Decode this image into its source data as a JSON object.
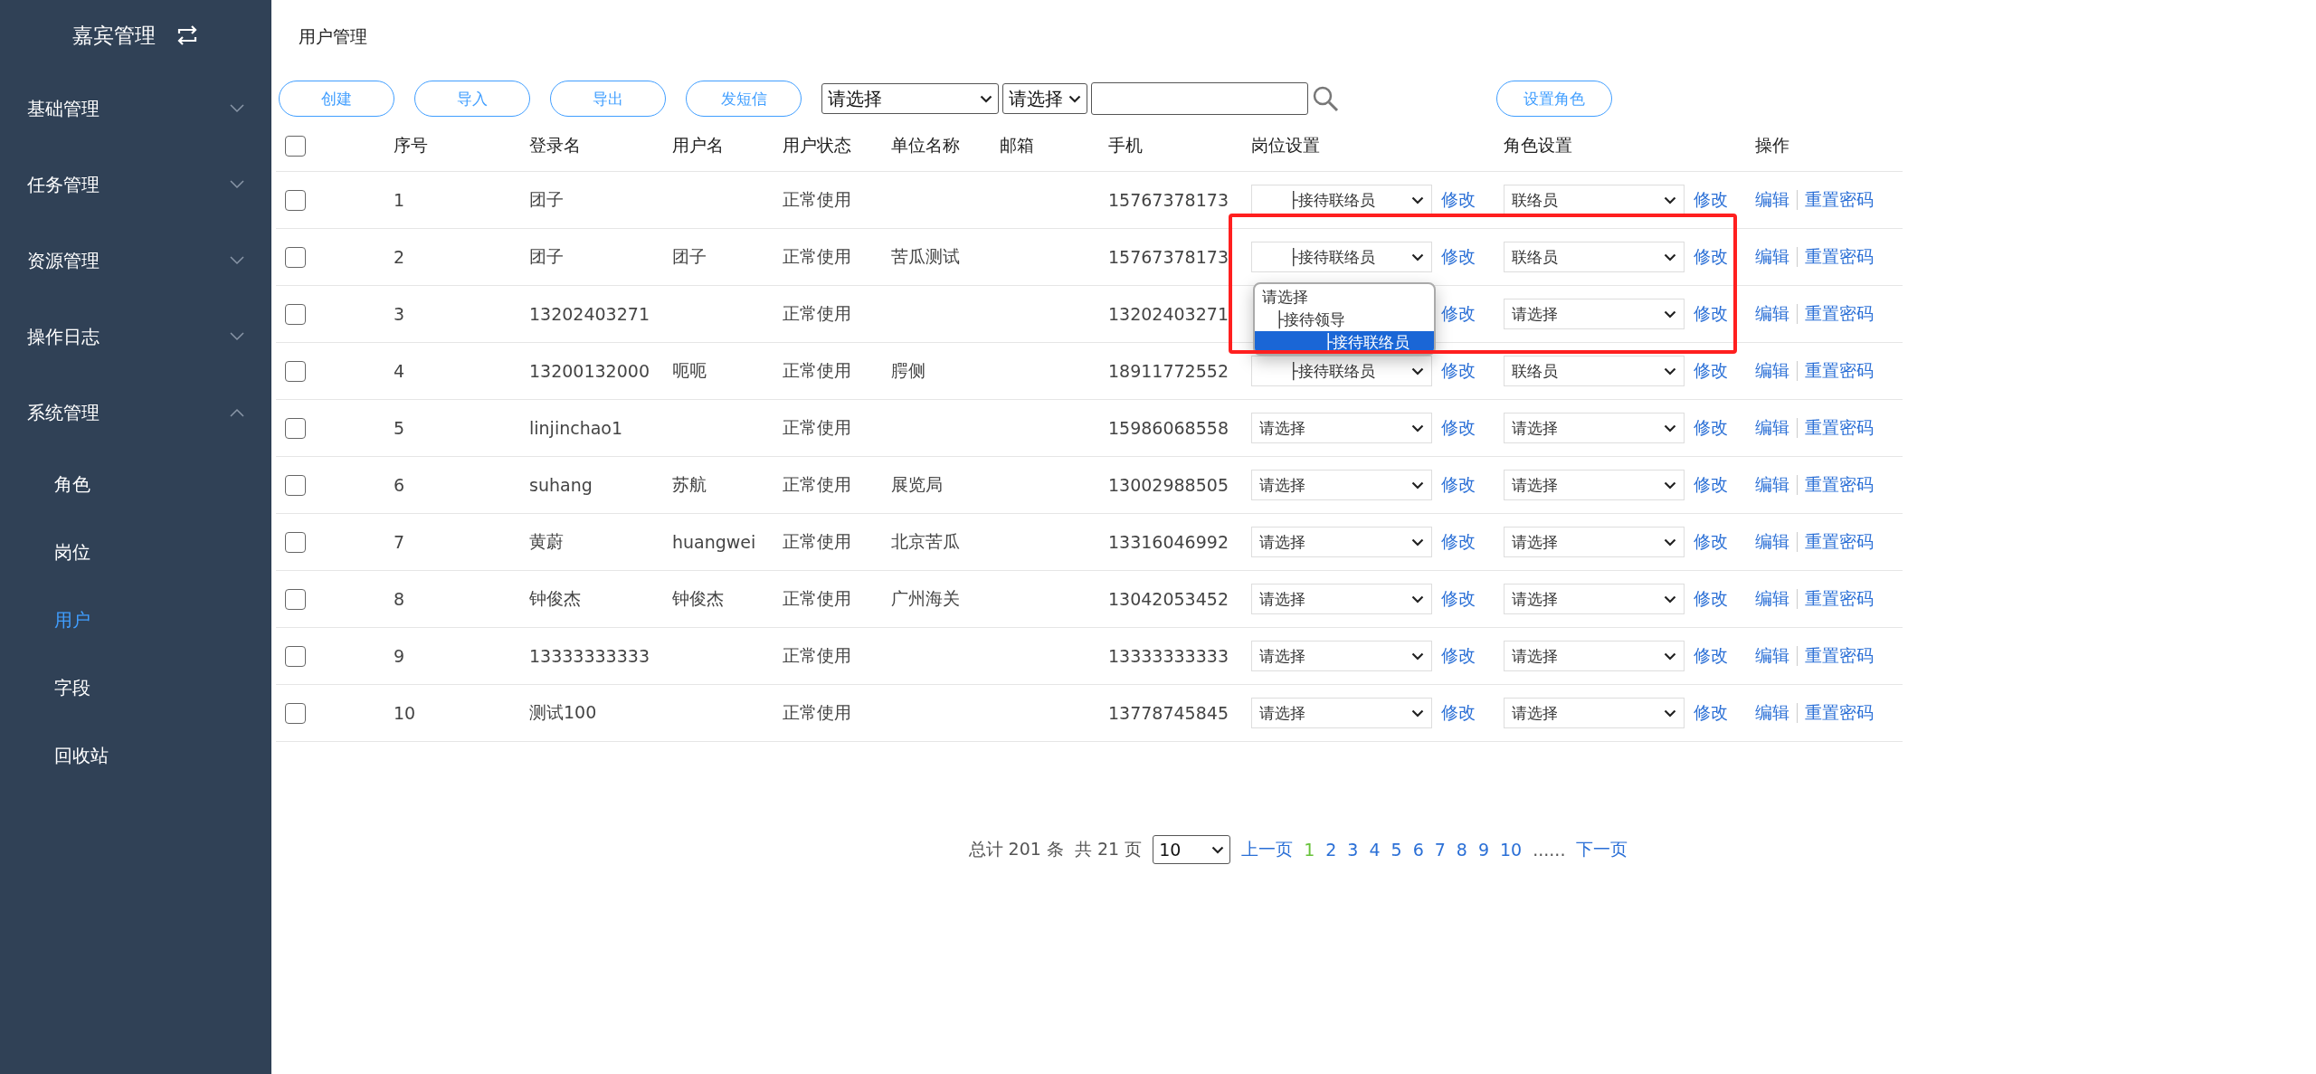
{
  "sidebar": {
    "title": "嘉宾管理",
    "items": [
      {
        "label": "基础管理",
        "expanded": false
      },
      {
        "label": "任务管理",
        "expanded": false
      },
      {
        "label": "资源管理",
        "expanded": false
      },
      {
        "label": "操作日志",
        "expanded": false
      },
      {
        "label": "系统管理",
        "expanded": true,
        "children": [
          {
            "label": "角色",
            "selected": false
          },
          {
            "label": "岗位",
            "selected": false
          },
          {
            "label": "用户",
            "selected": true
          },
          {
            "label": "字段",
            "selected": false
          },
          {
            "label": "回收站",
            "selected": false
          }
        ]
      }
    ]
  },
  "page_title": "用户管理",
  "toolbar": {
    "buttons": [
      "创建",
      "导入",
      "导出",
      "发短信"
    ],
    "selects": [
      "请选择",
      "请选择"
    ],
    "role_button": "设置角色"
  },
  "table": {
    "select_all_checked": false,
    "columns": [
      "序号",
      "登录名",
      "用户名",
      "用户状态",
      "单位名称",
      "邮箱",
      "手机",
      "岗位设置",
      "角色设置",
      "操作"
    ],
    "rows": [
      {
        "checked": false,
        "no": "1",
        "login": "团子",
        "name": "",
        "status": "正常使用",
        "unit": "",
        "email": "",
        "phone": "15767378173",
        "post": "      ├接待联络员",
        "role": "联络员",
        "modify": "修改",
        "role_modify": "修改",
        "edit": "编辑",
        "reset": "重置密码"
      },
      {
        "checked": false,
        "no": "2",
        "login": "团子",
        "name": "团子",
        "status": "正常使用",
        "unit": "苦瓜测试",
        "email": "",
        "phone": "15767378173",
        "post": "      ├接待联络员",
        "role": "联络员",
        "modify": "修改",
        "role_modify": "修改",
        "edit": "编辑",
        "reset": "重置密码",
        "post_dropdown": [
          {
            "label": "请选择",
            "selected": false,
            "children": [
              {
                "label": "├接待领导",
                "selected": false,
                "children": [
                  {
                    "label": "├接待联络员",
                    "selected": true
                  }
                ]
              }
            ]
          }
        ]
      },
      {
        "checked": false,
        "no": "3",
        "login": "13202403271",
        "name": "",
        "status": "正常使用",
        "unit": "",
        "email": "",
        "phone": "13202403271",
        "role": "请选择",
        "modify": "修改",
        "role_modify": "修改",
        "edit": "编辑",
        "reset": "重置密码"
      },
      {
        "checked": false,
        "no": "4",
        "login": "13200132000",
        "name": "呃呃",
        "status": "正常使用",
        "unit": "腭侧",
        "email": "",
        "phone": "18911772552",
        "post": "      ├接待联络员",
        "role": "联络员",
        "modify": "修改",
        "role_modify": "修改",
        "edit": "编辑",
        "reset": "重置密码"
      },
      {
        "checked": false,
        "no": "5",
        "login": "linjinchao1",
        "name": "",
        "status": "正常使用",
        "unit": "",
        "email": "",
        "phone": "15986068558",
        "post": "请选择",
        "role": "请选择",
        "modify": "修改",
        "role_modify": "修改",
        "edit": "编辑",
        "reset": "重置密码"
      },
      {
        "checked": false,
        "no": "6",
        "login": "suhang",
        "name": "苏航",
        "status": "正常使用",
        "unit": "展览局",
        "email": "",
        "phone": "13002988505",
        "post": "请选择",
        "role": "请选择",
        "modify": "修改",
        "role_modify": "修改",
        "edit": "编辑",
        "reset": "重置密码"
      },
      {
        "checked": false,
        "no": "7",
        "login": "黄蔚",
        "name": "huangwei",
        "status": "正常使用",
        "unit": "北京苦瓜",
        "email": "",
        "phone": "13316046992",
        "post": "请选择",
        "role": "请选择",
        "modify": "修改",
        "role_modify": "修改",
        "edit": "编辑",
        "reset": "重置密码"
      },
      {
        "checked": false,
        "no": "8",
        "login": "钟俊杰",
        "name": "钟俊杰",
        "status": "正常使用",
        "unit": "广州海关",
        "email": "",
        "phone": "13042053452",
        "post": "请选择",
        "role": "请选择",
        "modify": "修改",
        "role_modify": "修改",
        "edit": "编辑",
        "reset": "重置密码"
      },
      {
        "checked": false,
        "no": "9",
        "login": "13333333333",
        "name": "",
        "status": "正常使用",
        "unit": "",
        "email": "",
        "phone": "13333333333",
        "post": "请选择",
        "role": "请选择",
        "modify": "修改",
        "role_modify": "修改",
        "edit": "编辑",
        "reset": "重置密码"
      },
      {
        "checked": false,
        "no": "10",
        "login": "测试100",
        "name": "",
        "status": "正常使用",
        "unit": "",
        "email": "",
        "phone": "13778745845",
        "post": "请选择",
        "role": "请选择",
        "modify": "修改",
        "role_modify": "修改",
        "edit": "编辑",
        "reset": "重置密码"
      }
    ]
  },
  "pagination": {
    "total": "总计 201 条",
    "pages": "共 21 页",
    "page_size": "10",
    "prev": "上一页",
    "page_numbers": [
      {
        "label": "1",
        "selected": true
      },
      {
        "label": "2",
        "selected": false
      },
      {
        "label": "3",
        "selected": false
      },
      {
        "label": "4",
        "selected": false
      },
      {
        "label": "5",
        "selected": false
      },
      {
        "label": "6",
        "selected": false
      },
      {
        "label": "7",
        "selected": false
      },
      {
        "label": "8",
        "selected": false
      },
      {
        "label": "9",
        "selected": false
      },
      {
        "label": "10",
        "selected": false
      }
    ],
    "ellipsis": "......",
    "next": "下一页"
  }
}
